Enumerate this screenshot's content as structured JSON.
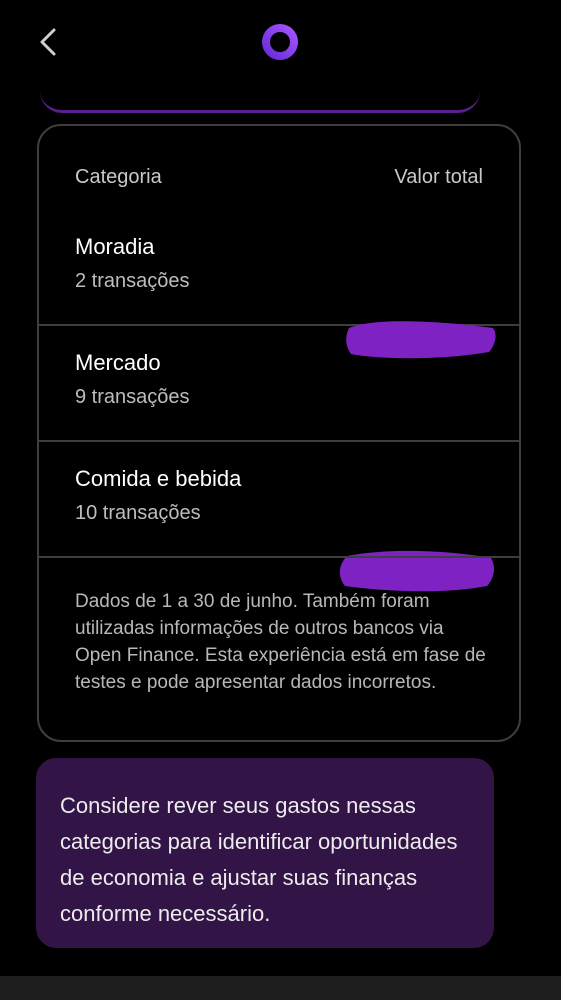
{
  "table": {
    "header_category": "Categoria",
    "header_total": "Valor total",
    "rows": [
      {
        "title": "Moradia",
        "subtitle": "2 transações"
      },
      {
        "title": "Mercado",
        "subtitle": "9 transações"
      },
      {
        "title": "Comida e bebida",
        "subtitle": "10 transações"
      }
    ],
    "footnote": "Dados de 1 a 30 de junho. Também foram utilizadas informações de outros bancos via Open Finance. Esta experiência está em fase de testes e pode apresentar dados incorretos."
  },
  "advice": {
    "text": "Considere rever seus gastos nessas categorias para identificar oportunidades de economia e ajustar suas finanças conforme necessário."
  },
  "icons": {
    "back": "chevron-left-icon",
    "logo": "ring-logo-icon"
  },
  "colors": {
    "background": "#000000",
    "accent": "#8a2be2",
    "redaction": "#7e22c4",
    "advice_bg": "#331447"
  }
}
